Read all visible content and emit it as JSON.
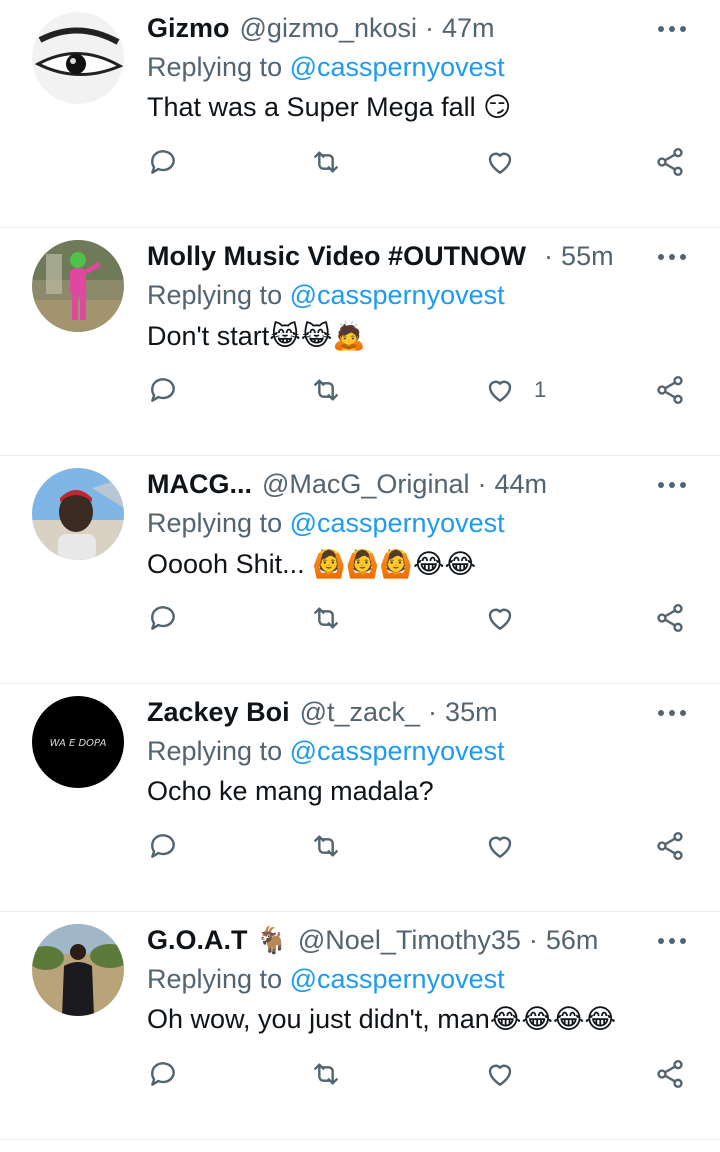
{
  "replies": [
    {
      "name": "Gizmo",
      "name_emoji": "",
      "handle": "@gizmo_nkosi",
      "time": "47m",
      "replying_prefix": "Replying to",
      "replying_to": "@casspernyovest",
      "text": "That was a Super Mega fall 😏",
      "like_count": "",
      "avatar": "eye-avatar"
    },
    {
      "name": "Molly Music Video #OUTNOW",
      "name_emoji": "",
      "handle": "",
      "time": "55m",
      "replying_prefix": "Replying to",
      "replying_to": "@casspernyovest",
      "text": "Don't start😹😹🙇",
      "like_count": "1",
      "avatar": "pink-figure-avatar"
    },
    {
      "name": "MACG...",
      "name_emoji": "",
      "handle": "@MacG_Original",
      "time": "44m",
      "replying_prefix": "Replying to",
      "replying_to": "@casspernyovest",
      "text": "Ooooh Shit... 🙆🙆🙆😂😂",
      "like_count": "",
      "avatar": "man-outdoors-avatar"
    },
    {
      "name": "Zackey Boi",
      "name_emoji": "",
      "handle": "@t_zack_",
      "time": "35m",
      "replying_prefix": "Replying to",
      "replying_to": "@casspernyovest",
      "text": "Ocho ke mang madala?",
      "like_count": "",
      "avatar": "wa-e-dopa-avatar",
      "avatar_text": "WA E DOPA"
    },
    {
      "name": "G.O.A.T",
      "name_emoji": "🐐",
      "handle": "@Noel_Timothy35",
      "time": "56m",
      "replying_prefix": "Replying to",
      "replying_to": "@casspernyovest",
      "text": "Oh wow, you just didn't, man😂😂😂😂",
      "like_count": "",
      "avatar": "man-in-suit-avatar"
    }
  ],
  "colors": {
    "text": "#0f1419",
    "muted": "#536471",
    "link": "#1d9bf0",
    "divider": "#e6ecf0"
  },
  "icons": [
    "reply-icon",
    "retweet-icon",
    "like-icon",
    "share-icon",
    "more-icon"
  ]
}
